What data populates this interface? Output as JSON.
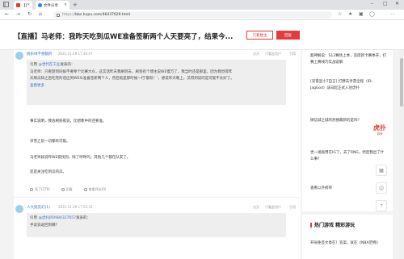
{
  "browser": {
    "tab_active": "【直播】马老师：我昨...",
    "tab_second": "文件分享",
    "url": "https://bbs.hupu.com/46437629.html",
    "url_prefix": "https://",
    "url_rest": "bbs.hupu.com/46437629.html"
  },
  "header": {
    "title": "【直播】马老师：我昨天吃到瓜WE准备签新两个人天要亮了，结果今...",
    "only_author_label": "只看楼主",
    "reply_label": "回复"
  },
  "posts": [
    {
      "author": "桃乐绿不想翻药",
      "time": "2021-11-29 17:34:47",
      "actions": [
        "点灭",
        "只看此用户",
        "引用"
      ],
      "quote_author": "@世代在工业",
      "quote_header_rest": "发表的：",
      "quote_lines": [
        "马老师：只看登到同候不要奉个比赛大众，这实话昨天我刷到去，刷到有个博主说WE慢万了，我当时还是那里，因为我觉得昨",
        "天刷瓜知之后吃完的话应到WE众准备签新两个人，然后就是那时候一行'都双！'，想说昨天晚上，又得到说的是可能不太好了。",
        "查看更多"
      ],
      "replies": [
        "事实说明，我会刷统夜说，比想象中的还要准。",
        "深雪之前一切都有可能。",
        "马老师就说昨WE挺找到，除了呼呼的，其他几个都在队友了。",
        "还是关注吃到瓜的瓜。"
      ],
      "footer": [
        "亮了(279)",
        "回复",
        "查看评论(0)"
      ]
    },
    {
      "author": "人大抵见幻(1)",
      "time": "2021-11-29 17:53:32",
      "actions": [
        "点灭",
        "只看此用户",
        "引用"
      ],
      "quote_author": "@虎扑JR0984327657",
      "quote_header_rest": "发表的：",
      "quote_lines": [
        "手说说返回到哪？"
      ]
    }
  ],
  "sidebar": {
    "items": [
      "超神解说：S12赛场上季，首席新卡赛季开，打赛上赛线巧实战说解",
      "[深夜宣小T自言] 打野去手游全程（ID：JagGod）该日起正式入驻虎扑",
      "微信城之城的热搜最新的是吗？",
      "世一涵竟用在IG了，去了RNG，然后我出了什么事？"
    ],
    "more_label": "查看更多",
    "more_link": "查看以外榜单",
    "hot_title": "热门游戏 精彩游玩",
    "hot_first": "开局免签文章在！答案，就在《NBA范特》"
  },
  "gift": {
    "main": "虎扑",
    "sub": "游戏"
  }
}
